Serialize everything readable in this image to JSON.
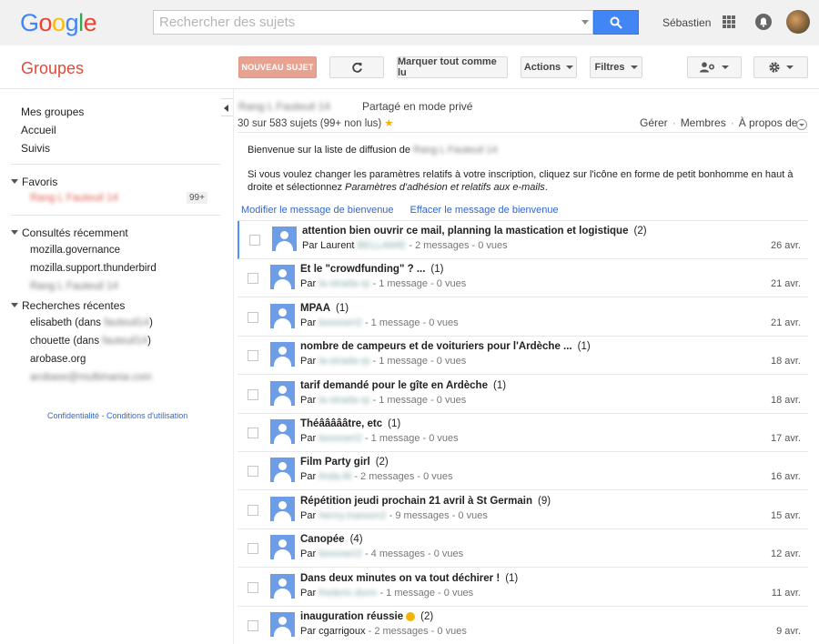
{
  "header": {
    "logo": "Google",
    "logo_colors": [
      "#4285f4",
      "#ea4335",
      "#fbbc05",
      "#4285f4",
      "#34a853",
      "#ea4335"
    ],
    "search_placeholder": "Rechercher des sujets",
    "user_name": "Sébastien"
  },
  "app": {
    "title": "Groupes"
  },
  "toolbar": {
    "new_topic": "NOUVEAU SUJET",
    "mark_all_read": "Marquer tout comme lu",
    "actions": "Actions",
    "filters": "Filtres"
  },
  "sidebar": {
    "my_groups": "Mes groupes",
    "home": "Accueil",
    "followed": "Suivis",
    "favorites_header": "Favoris",
    "favorite_group": "Rang L Fauteuil 14",
    "favorite_badge": "99+",
    "recent_header": "Consultés récemment",
    "recent": [
      "mozilla.governance",
      "mozilla.support.thunderbird",
      "Rang L Fauteuil 14"
    ],
    "searches_header": "Recherches récentes",
    "searches": [
      {
        "prefix": "elisabeth (dans ",
        "blur": "fauteuil14",
        "suffix": ")"
      },
      {
        "prefix": "chouette (dans ",
        "blur": "fauteuil14",
        "suffix": ")"
      },
      {
        "prefix": "arobase.org",
        "blur": "",
        "suffix": ""
      },
      {
        "prefix": "",
        "blur": "arobase@multimania.com",
        "suffix": ""
      }
    ],
    "privacy": "Confidentialité",
    "terms": "Conditions d'utilisation"
  },
  "main": {
    "group_name": "Rang L Fauteuil 14",
    "shared": "Partagé en mode privé",
    "counts": "30 sur 583 sujets (99+ non lus)",
    "manage": "Gérer",
    "members": "Membres",
    "about": "À propos de",
    "welcome_line1": "Bienvenue sur la liste de diffusion de ",
    "welcome_group": "Rang L Fauteuil 14",
    "welcome_line2a": "Si vous voulez changer les paramètres relatifs à votre inscription, cliquez sur l'icône en forme de petit bonhomme en haut à droite et sélectionnez ",
    "welcome_line2b": "Paramètres d'adhésion et relatifs aux e-mails",
    "welcome_line2c": ".",
    "edit_welcome": "Modifier le message de bienvenue",
    "delete_welcome": "Effacer le message de bienvenue"
  },
  "topics": [
    {
      "subject": "attention bien ouvrir ce mail, planning la mastication et logistique",
      "count": "(2)",
      "by": "Par Laurent ",
      "author": "BELLAMIE",
      "info": " - 2 messages - 0 vues",
      "date": "26 avr."
    },
    {
      "subject": "Et le \"crowdfunding\" ? ...",
      "count": "(1)",
      "by": "Par ",
      "author": "la-strada-rp",
      "info": " - 1 message - 0 vues",
      "date": "21 avr."
    },
    {
      "subject": "MPAA",
      "count": "(1)",
      "by": "Par ",
      "author": "bossoeri2",
      "info": " - 1 message - 0 vues",
      "date": "21 avr."
    },
    {
      "subject": "nombre de campeurs et de voituriers pour l'Ardèche ...",
      "count": "(1)",
      "by": "Par ",
      "author": "la-strada-rp",
      "info": " - 1 message - 0 vues",
      "date": "18 avr."
    },
    {
      "subject": "tarif demandé pour le gîte en Ardèche",
      "count": "(1)",
      "by": "Par ",
      "author": "la-strada-rp",
      "info": " - 1 message - 0 vues",
      "date": "18 avr."
    },
    {
      "subject": "Théâââââtre, etc",
      "count": "(1)",
      "by": "Par ",
      "author": "bossoeri2",
      "info": " - 1 message - 0 vues",
      "date": "17 avr."
    },
    {
      "subject": "Film Party girl",
      "count": "(2)",
      "by": "Par ",
      "author": "linda.lili",
      "info": " - 2 messages - 0 vues",
      "date": "16 avr."
    },
    {
      "subject": "Répétition jeudi prochain 21 avril à St Germain",
      "count": "(9)",
      "by": "Par ",
      "author": "henry.masson2",
      "info": " - 9 messages - 0 vues",
      "date": "15 avr."
    },
    {
      "subject": "Canopée",
      "count": "(4)",
      "by": "Par ",
      "author": "bossoeri2",
      "info": " - 4 messages - 0 vues",
      "date": "12 avr."
    },
    {
      "subject": "Dans deux minutes on va tout déchirer !",
      "count": "(1)",
      "by": "Par ",
      "author": "frederic.dunn",
      "info": " - 1 message - 0 vues",
      "date": "11 avr."
    },
    {
      "subject": "inauguration réussie",
      "count": "(2)",
      "by": "Par cgarrigoux",
      "author": "",
      "info": " - 2 messages - 0 vues",
      "date": "9 avr."
    }
  ]
}
